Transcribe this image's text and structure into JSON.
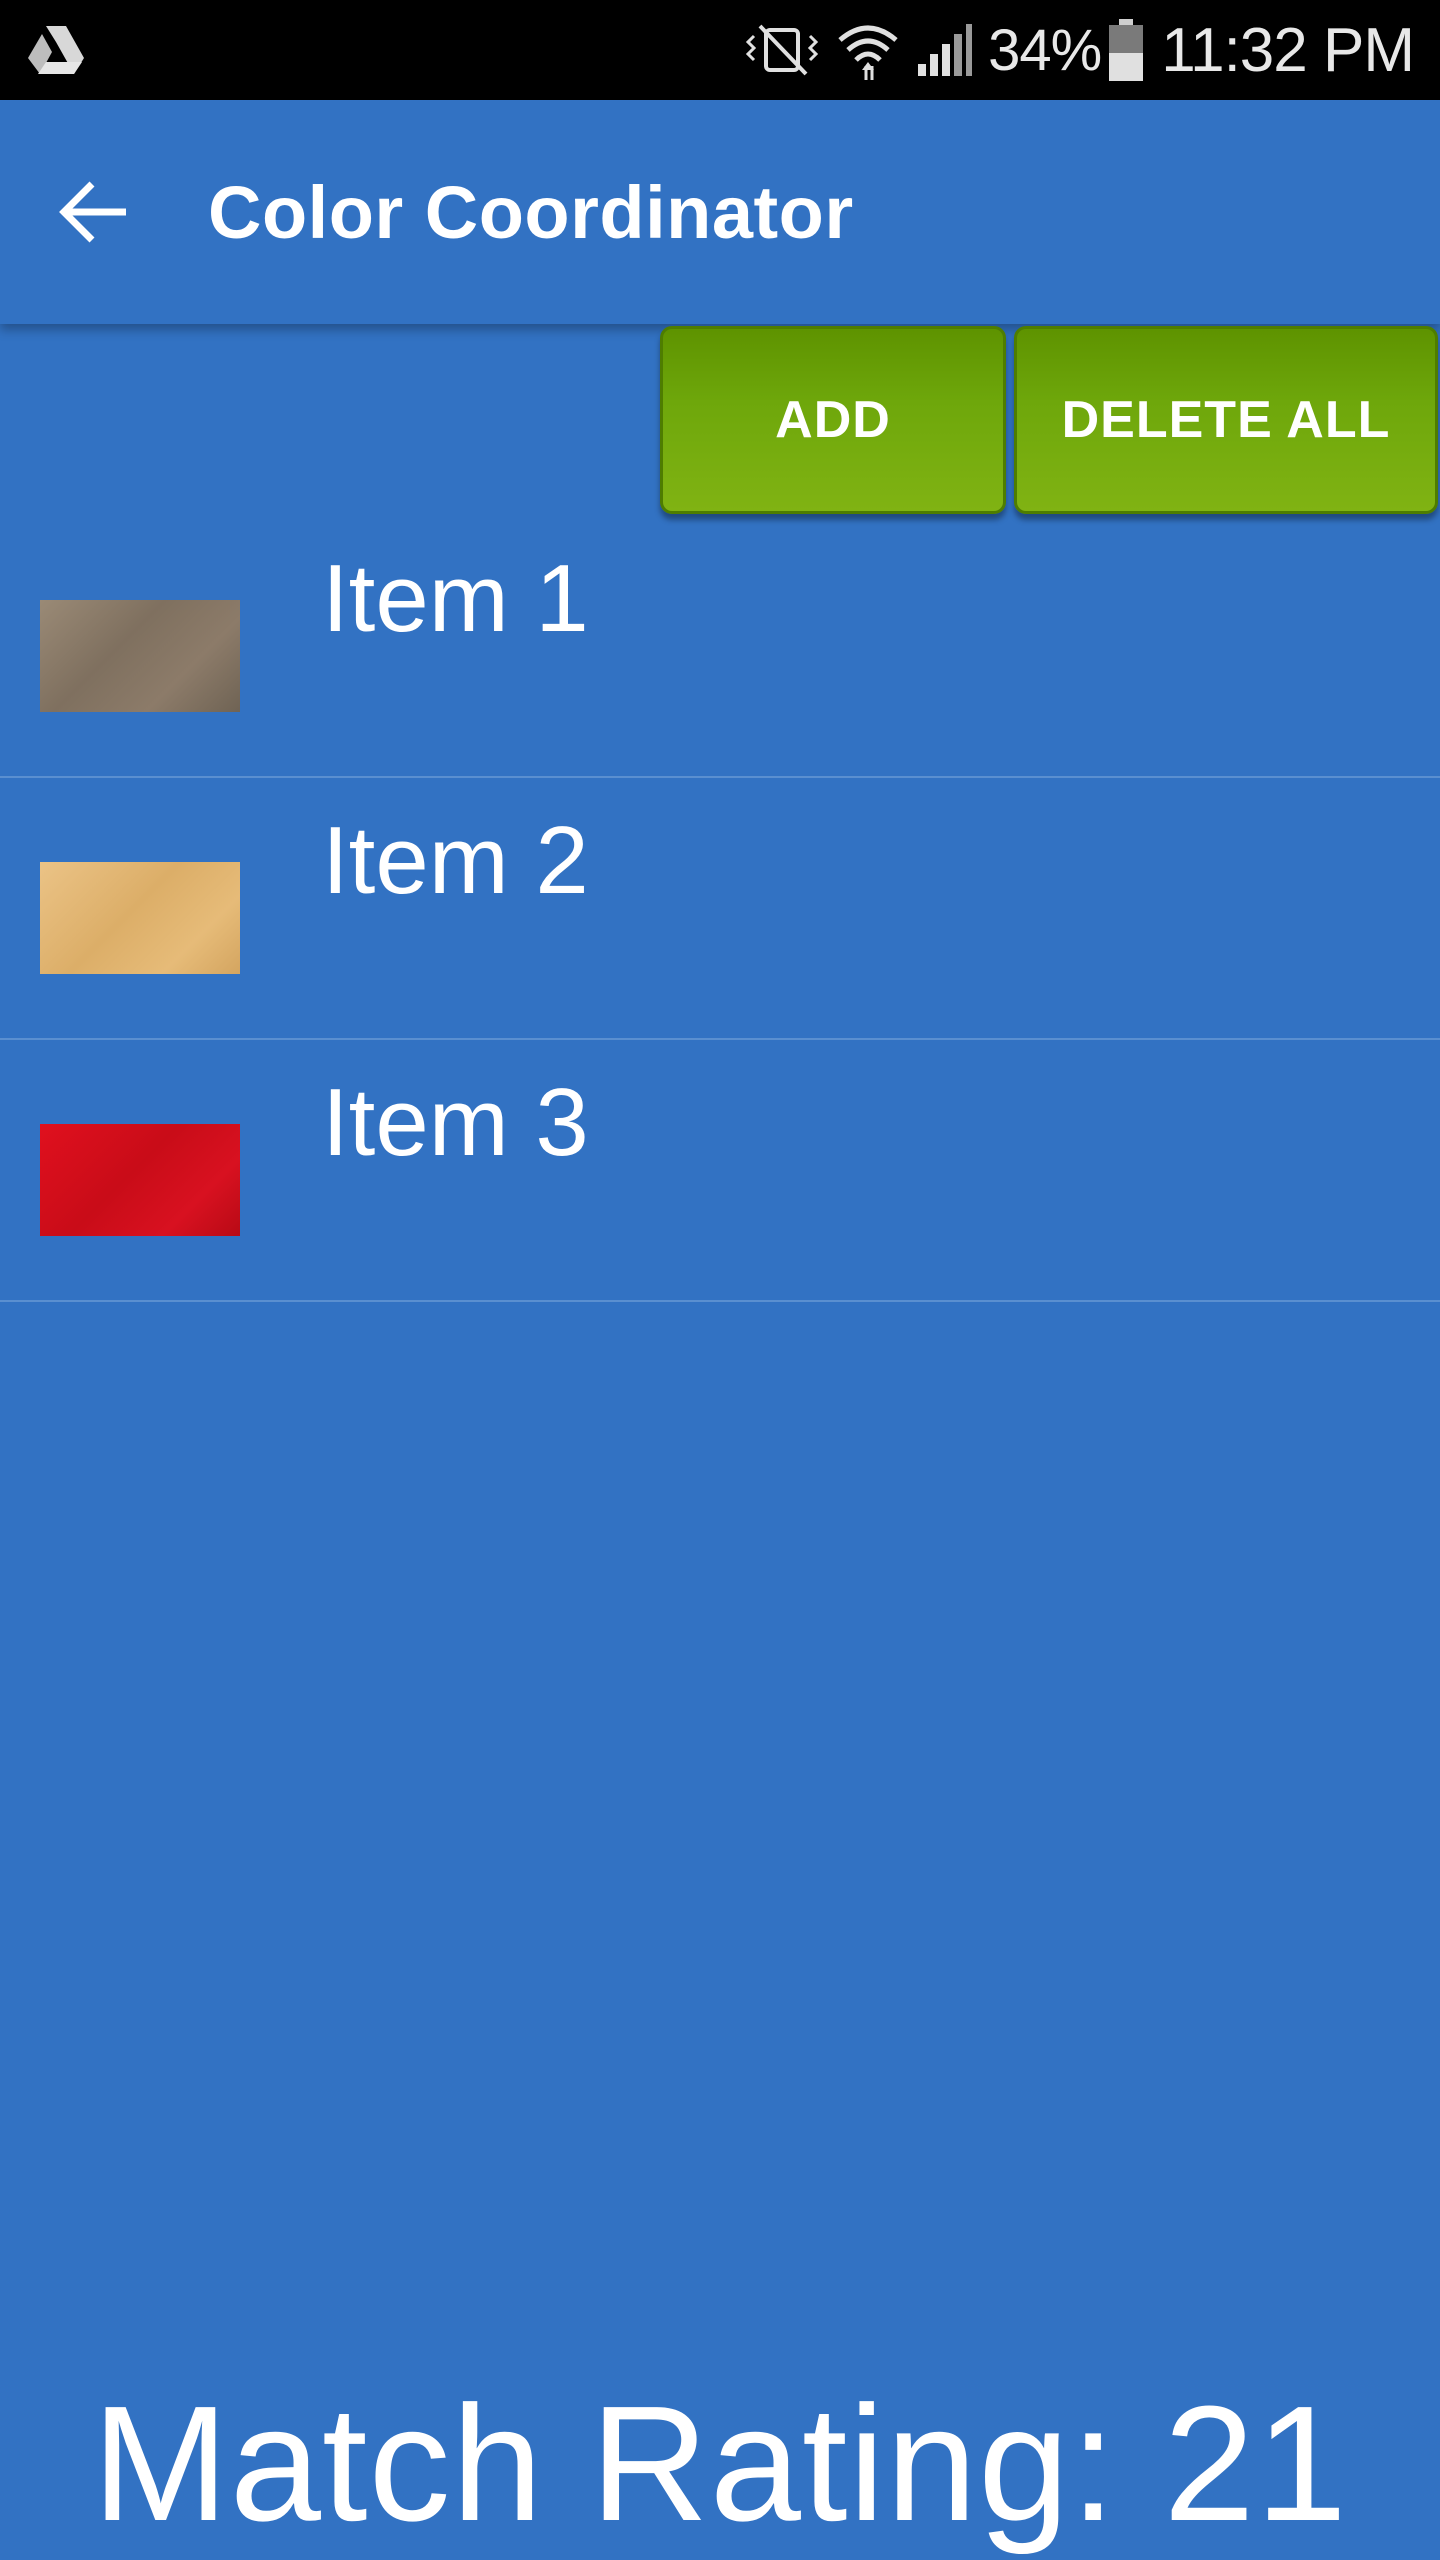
{
  "status_bar": {
    "battery": "34%",
    "time": "11:32 PM",
    "icons": [
      "drive-icon",
      "mute-vibrate-icon",
      "wifi-icon",
      "cell-signal-icon",
      "battery-icon"
    ]
  },
  "app_bar": {
    "title": "Color Coordinator",
    "back_icon": "arrow-back-icon"
  },
  "actions": {
    "add_label": "ADD",
    "delete_all_label": "DELETE ALL"
  },
  "items": [
    {
      "label": "Item 1",
      "swatch_color": "#8a7966"
    },
    {
      "label": "Item 2",
      "swatch_color": "#dfb36e"
    },
    {
      "label": "Item 3",
      "swatch_color": "#d20f1c"
    }
  ],
  "footer": {
    "match_rating": "Match Rating: 21"
  },
  "colors": {
    "background": "#3272c3",
    "button_green": "#6ea70b",
    "status_bar": "#000000"
  }
}
